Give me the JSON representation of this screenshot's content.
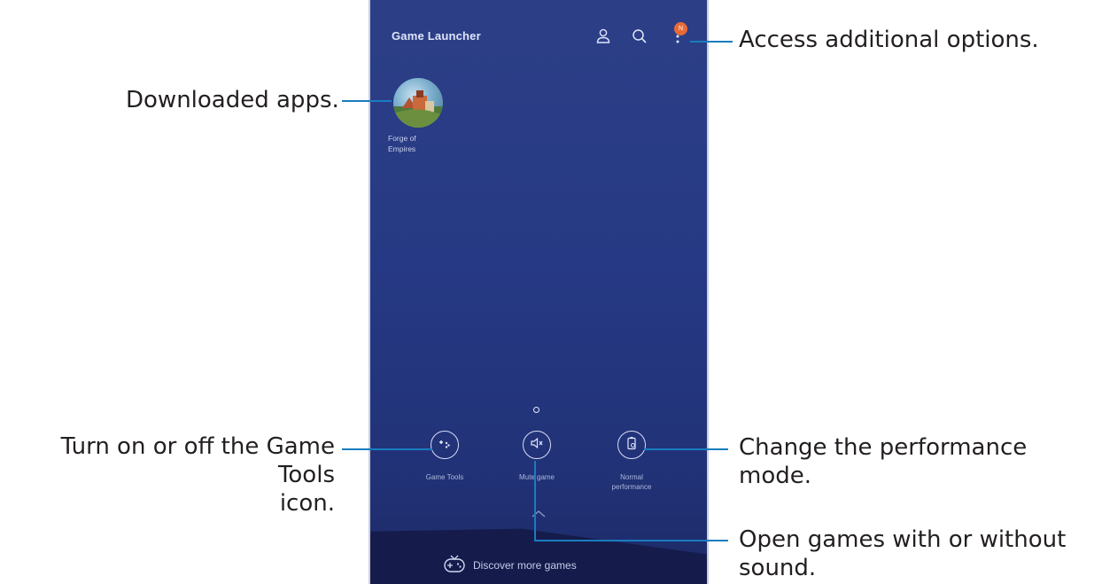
{
  "app": {
    "title": "Game Launcher",
    "header_icons": [
      "profile-icon",
      "search-icon",
      "more-options-icon"
    ],
    "badge": "N"
  },
  "apps": [
    {
      "name": "Forge of Empires",
      "label_line1": "Forge of",
      "label_line2": "Empires"
    }
  ],
  "tools": [
    {
      "label": "Game Tools",
      "icon": "game-tools-icon"
    },
    {
      "label": "Mute game",
      "icon": "mute-icon"
    },
    {
      "label_line1": "Normal",
      "label_line2": "performance",
      "icon": "performance-icon"
    }
  ],
  "bottom": {
    "discover": "Discover more games"
  },
  "annotations": {
    "options": "Access additional options.",
    "downloaded": "Downloaded apps.",
    "tools_line1": "Turn on or off the Game Tools",
    "tools_line2": "icon.",
    "performance": "Change the performance mode.",
    "mute_line1": "Open games with or without",
    "mute_line2": "sound."
  },
  "colors": {
    "accent": "#1a7cc0",
    "badge": "#e96a36",
    "screen": "#263984"
  }
}
